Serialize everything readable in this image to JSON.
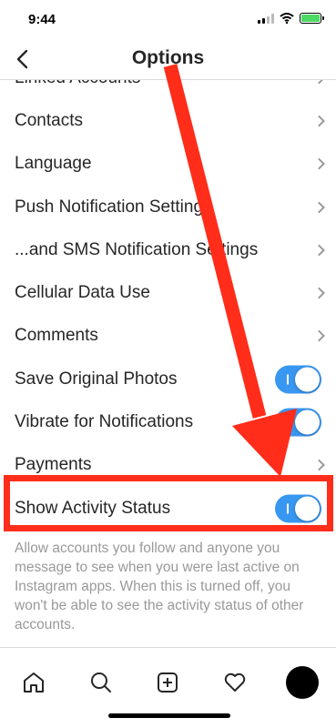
{
  "status_bar": {
    "time": "9:44"
  },
  "nav": {
    "title": "Options"
  },
  "rows": [
    {
      "label": "Linked Accounts",
      "control": "chevron"
    },
    {
      "label": "Contacts",
      "control": "chevron"
    },
    {
      "label": "Language",
      "control": "chevron"
    },
    {
      "label": "Push Notification Settings",
      "control": "chevron"
    },
    {
      "label": "...and SMS Notification Settings",
      "control": "chevron"
    },
    {
      "label": "Cellular Data Use",
      "control": "chevron"
    },
    {
      "label": "Comments",
      "control": "chevron"
    },
    {
      "label": "Save Original Photos",
      "control": "toggle",
      "on": true
    },
    {
      "label": "Vibrate for Notifications",
      "control": "toggle",
      "on": true
    },
    {
      "label": "Payments",
      "control": "chevron"
    },
    {
      "label": "Show Activity Status",
      "control": "toggle",
      "on": true
    }
  ],
  "description": "Allow accounts you follow and anyone you message to see when you were last active on Instagram apps. When this is turned off, you won't be able to see the activity status of other accounts.",
  "tab_bar": {
    "tabs": [
      {
        "name": "home-icon"
      },
      {
        "name": "search-icon"
      },
      {
        "name": "new-post-icon"
      },
      {
        "name": "heart-icon"
      },
      {
        "name": "profile-avatar"
      }
    ]
  },
  "colors": {
    "toggle_on": "#3897f0",
    "annotation": "#ff2d1a",
    "battery": "#4cd964"
  }
}
